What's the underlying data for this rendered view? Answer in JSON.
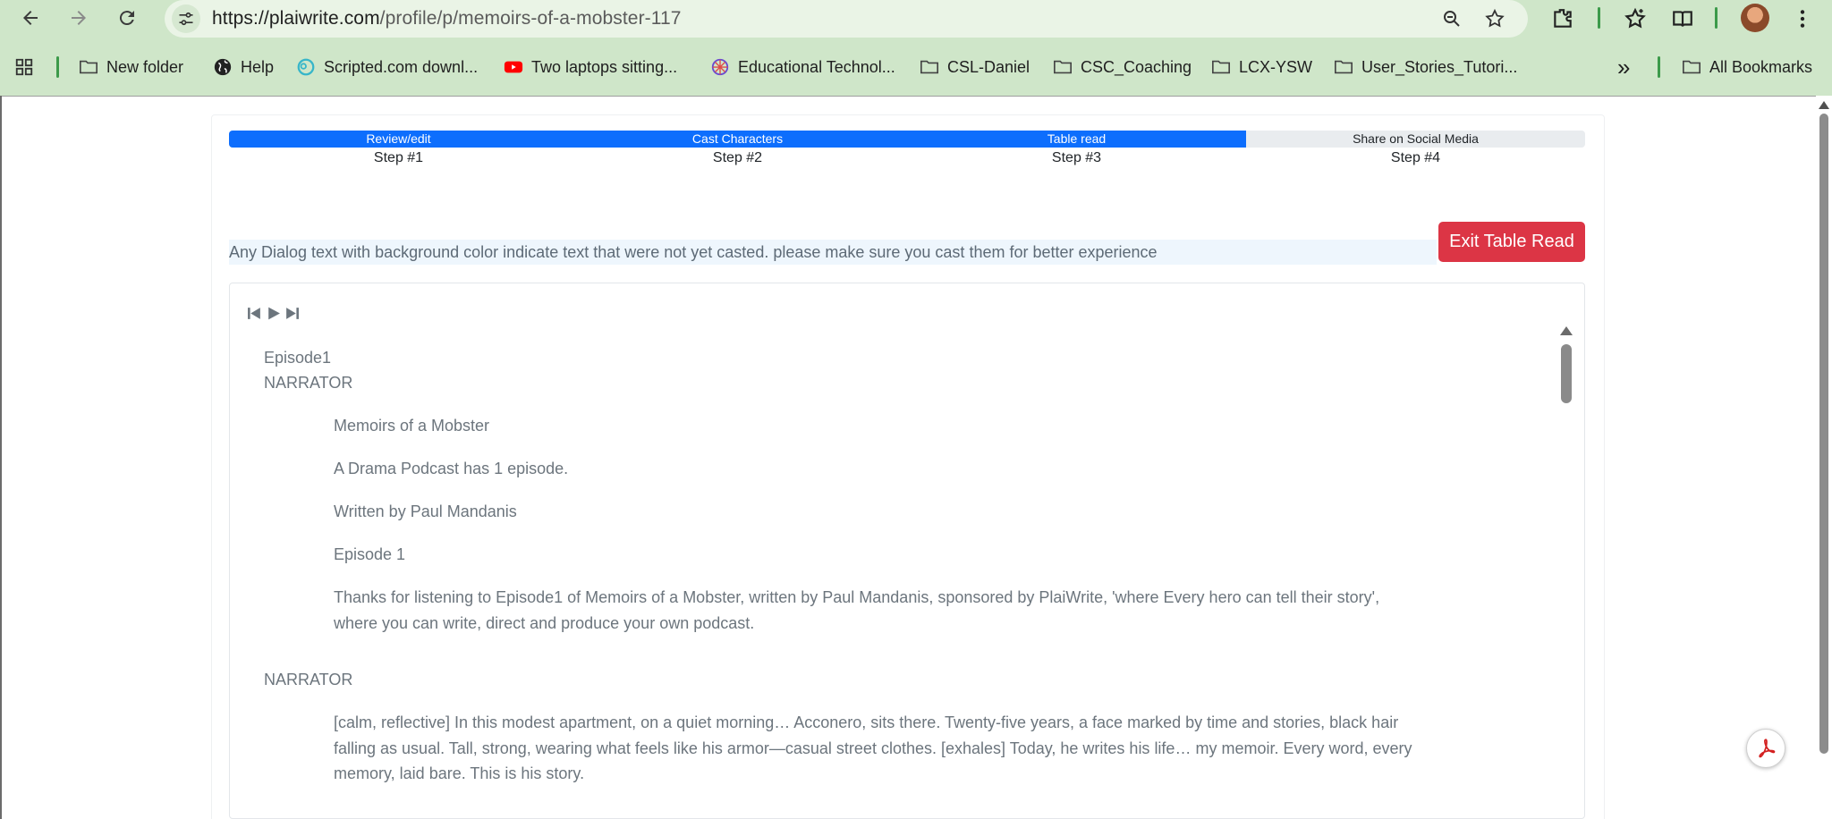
{
  "browser": {
    "url_host": "https://plaiwrite.com",
    "url_path": "/profile/p/memoirs-of-a-mobster-117",
    "bookmarks": [
      {
        "label": "New folder",
        "icon": "folder-icon"
      },
      {
        "label": "Help",
        "icon": "globe-icon"
      },
      {
        "label": "Scripted.com downl...",
        "icon": "scripted-logo-icon"
      },
      {
        "label": "Two laptops sitting...",
        "icon": "youtube-icon"
      },
      {
        "label": "Educational Technol...",
        "icon": "edtech-logo-icon"
      },
      {
        "label": "CSL-Daniel",
        "icon": "folder-icon"
      },
      {
        "label": "CSC_Coaching",
        "icon": "folder-icon"
      },
      {
        "label": "LCX-YSW",
        "icon": "folder-icon"
      },
      {
        "label": "User_Stories_Tutori...",
        "icon": "folder-icon"
      }
    ],
    "more_bookmarks": "»",
    "all_bookmarks": "All Bookmarks"
  },
  "progress": {
    "value": 0.75,
    "accent_color": "#0d6efd",
    "steps": [
      {
        "label": "Review/edit",
        "number": "Step #1",
        "done": true
      },
      {
        "label": "Cast Characters",
        "number": "Step #2",
        "done": true
      },
      {
        "label": "Table read",
        "number": "Step #3",
        "done": true
      },
      {
        "label": "Share on Social Media",
        "number": "Step #4",
        "done": false
      }
    ]
  },
  "notice_text": "Any Dialog text with background color indicate text that were not yet casted. please make sure you cast them for better experience",
  "exit_button_label": "Exit Table Read",
  "exit_button_color": "#dc3545",
  "player": {
    "controls": [
      "skip-back-icon",
      "play-icon",
      "skip-forward-icon"
    ]
  },
  "script": {
    "episode_title": "Episode1",
    "blocks": [
      {
        "speaker": "NARRATOR",
        "lines": [
          "Memoirs of a Mobster",
          "A Drama Podcast has 1 episode.",
          "Written by Paul Mandanis",
          "Episode 1",
          "Thanks for listening to Episode1 of Memoirs of a Mobster, written by Paul Mandanis, sponsored by PlaiWrite, 'where Every hero can tell their story', where you can write, direct and produce your own podcast."
        ]
      },
      {
        "speaker": "NARRATOR",
        "lines": [
          "[calm, reflective] In this modest apartment, on a quiet morning… Acconero, sits there. Twenty-five years, a face marked by time and stories, black hair falling as usual. Tall, strong, wearing what feels like his armor—casual street clothes. [exhales] Today, he writes his life… my memoir. Every word, every memory, laid bare. This is his story."
        ]
      }
    ]
  }
}
